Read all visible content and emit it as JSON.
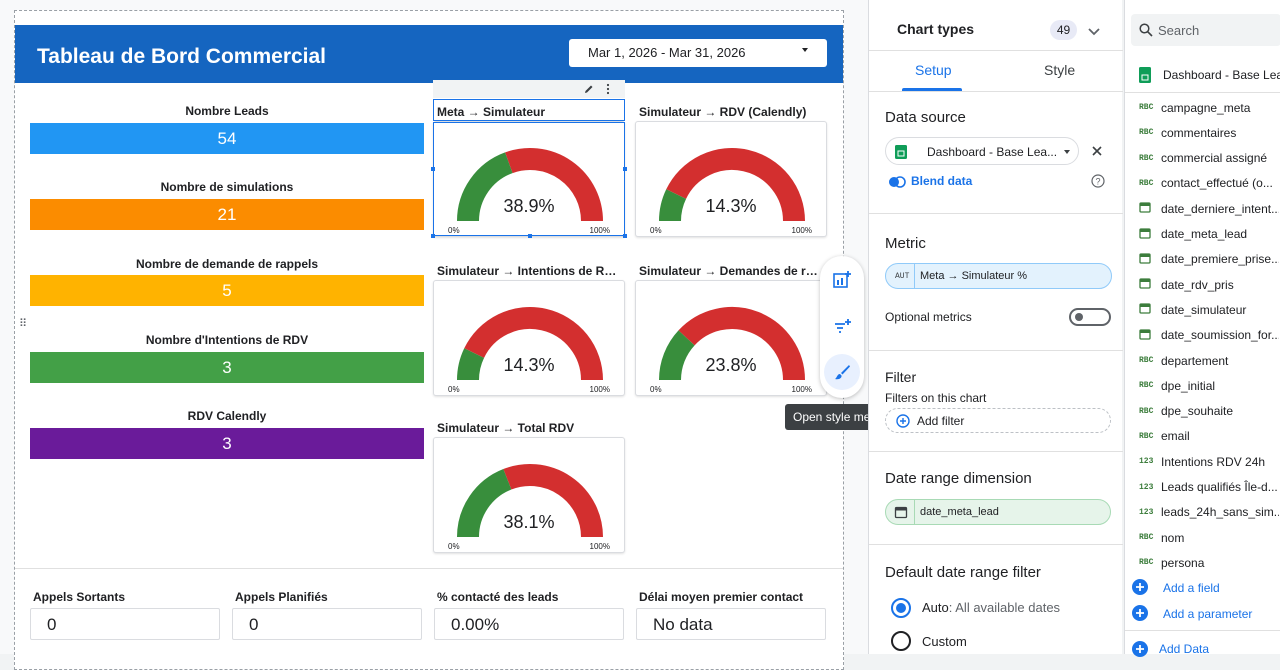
{
  "report": {
    "title": "Tableau de Bord Commercial",
    "date_range": "Mar 1, 2026 - Mar 31, 2026"
  },
  "kpis": [
    {
      "label": "Nombre Leads",
      "value": "54",
      "color": "#2196f3"
    },
    {
      "label": "Nombre de simulations",
      "value": "21",
      "color": "#fb8c00"
    },
    {
      "label": "Nombre de demande de rappels",
      "value": "5",
      "color": "#ffb300"
    },
    {
      "label": "Nombre d'Intentions de RDV",
      "value": "3",
      "color": "#43a047"
    },
    {
      "label": "RDV Calendly",
      "value": "3",
      "color": "#6a1b9a"
    }
  ],
  "gauges": [
    {
      "title": "Meta → Simulateur",
      "value_text": "38.9%",
      "value": 38.9,
      "min": "0%",
      "max": "100%"
    },
    {
      "title": "Simulateur → RDV (Calendly)",
      "value_text": "14.3%",
      "value": 14.3,
      "min": "0%",
      "max": "100%"
    },
    {
      "title": "Simulateur → Intentions de R…",
      "value_text": "14.3%",
      "value": 14.3,
      "min": "0%",
      "max": "100%"
    },
    {
      "title": "Simulateur → Demandes de r…",
      "value_text": "23.8%",
      "value": 23.8,
      "min": "0%",
      "max": "100%"
    },
    {
      "title": "Simulateur → Total RDV",
      "value_text": "38.1%",
      "value": 38.1,
      "min": "0%",
      "max": "100%"
    }
  ],
  "gauge_colors": {
    "filled": "#388e3c",
    "empty": "#d32f2f"
  },
  "scorecards": [
    {
      "label": "Appels Sortants",
      "value": "0"
    },
    {
      "label": "Appels Planifiés",
      "value": "0"
    },
    {
      "label": "% contacté des leads",
      "value": "0.00%"
    },
    {
      "label": "Délai moyen premier contact",
      "value": "No data"
    }
  ],
  "tooltip": "Open style menu",
  "properties": {
    "chart_types_label": "Chart types",
    "chart_types_count": "49",
    "tabs": {
      "setup": "Setup",
      "style": "Style"
    },
    "data_source_title": "Data source",
    "data_source_value": "Dashboard - Base Lea...",
    "blend_label": "Blend data",
    "metric_title": "Metric",
    "metric_type": "AUT",
    "metric_value": "Meta → Simulateur %",
    "optional_metrics": "Optional metrics",
    "filter_title": "Filter",
    "filter_sub": "Filters on this chart",
    "add_filter": "Add filter",
    "date_dim_title": "Date range dimension",
    "date_dim_value": "date_meta_lead",
    "default_date_title": "Default date range filter",
    "auto_label": "Auto",
    "auto_sub": ": All available dates",
    "custom_label": "Custom",
    "accent": "#1a73e8"
  },
  "data_panel": {
    "search_placeholder": "Search",
    "source_name": "Dashboard - Base Lea...",
    "fields": [
      {
        "type": "RBC",
        "name": "campagne_meta"
      },
      {
        "type": "RBC",
        "name": "commentaires"
      },
      {
        "type": "RBC",
        "name": "commercial assigné"
      },
      {
        "type": "RBC",
        "name": "contact_effectué (o..."
      },
      {
        "type": "date",
        "name": "date_derniere_intent..."
      },
      {
        "type": "date",
        "name": "date_meta_lead"
      },
      {
        "type": "date",
        "name": "date_premiere_prise..."
      },
      {
        "type": "date",
        "name": "date_rdv_pris"
      },
      {
        "type": "date",
        "name": "date_simulateur"
      },
      {
        "type": "date",
        "name": "date_soumission_for..."
      },
      {
        "type": "RBC",
        "name": "departement"
      },
      {
        "type": "RBC",
        "name": "dpe_initial"
      },
      {
        "type": "RBC",
        "name": "dpe_souhaite"
      },
      {
        "type": "RBC",
        "name": "email"
      },
      {
        "type": "123",
        "name": "Intentions RDV 24h"
      },
      {
        "type": "123",
        "name": "Leads qualifiés Île-d..."
      },
      {
        "type": "123",
        "name": "leads_24h_sans_sim..."
      },
      {
        "type": "RBC",
        "name": "nom"
      },
      {
        "type": "RBC",
        "name": "persona"
      }
    ],
    "add_field": "Add a field",
    "add_parameter": "Add a parameter",
    "add_data": "Add Data"
  }
}
